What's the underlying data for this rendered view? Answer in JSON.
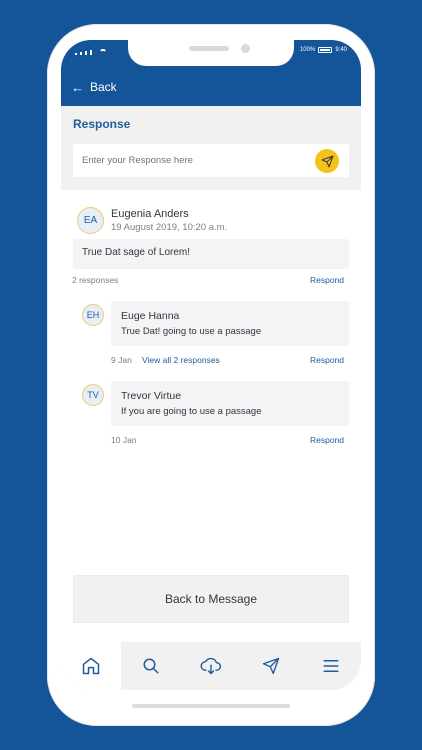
{
  "status_bar": {
    "battery": "100%",
    "time": "9:40"
  },
  "header": {
    "back_label": "Back"
  },
  "response": {
    "label": "Response",
    "placeholder": "Enter your Response here"
  },
  "post": {
    "initials": "EA",
    "author": "Eugenia Anders",
    "date": "19 August 2019, 10:20 a.m.",
    "text": "True Dat sage of Lorem!",
    "responses_count": "2 responses",
    "respond_label": "Respond"
  },
  "replies": [
    {
      "initials": "EH",
      "author": "Euge Hanna",
      "text": "True Dat! going to use a passage",
      "date": "9 Jan",
      "view_all": "View all 2 responses",
      "respond_label": "Respond"
    },
    {
      "initials": "TV",
      "author": "Trevor Virtue",
      "text": "If you are going to use a passage",
      "date": "10 Jan",
      "respond_label": "Respond"
    }
  ],
  "footer": {
    "back_to_message": "Back to Message"
  },
  "tabbar": {
    "items": [
      "home-icon",
      "search-icon",
      "cloud-download-icon",
      "send-icon",
      "menu-icon"
    ],
    "active": "home-icon"
  },
  "colors": {
    "primary": "#145499",
    "accent": "#f4c21c",
    "link": "#1f5d9c"
  }
}
